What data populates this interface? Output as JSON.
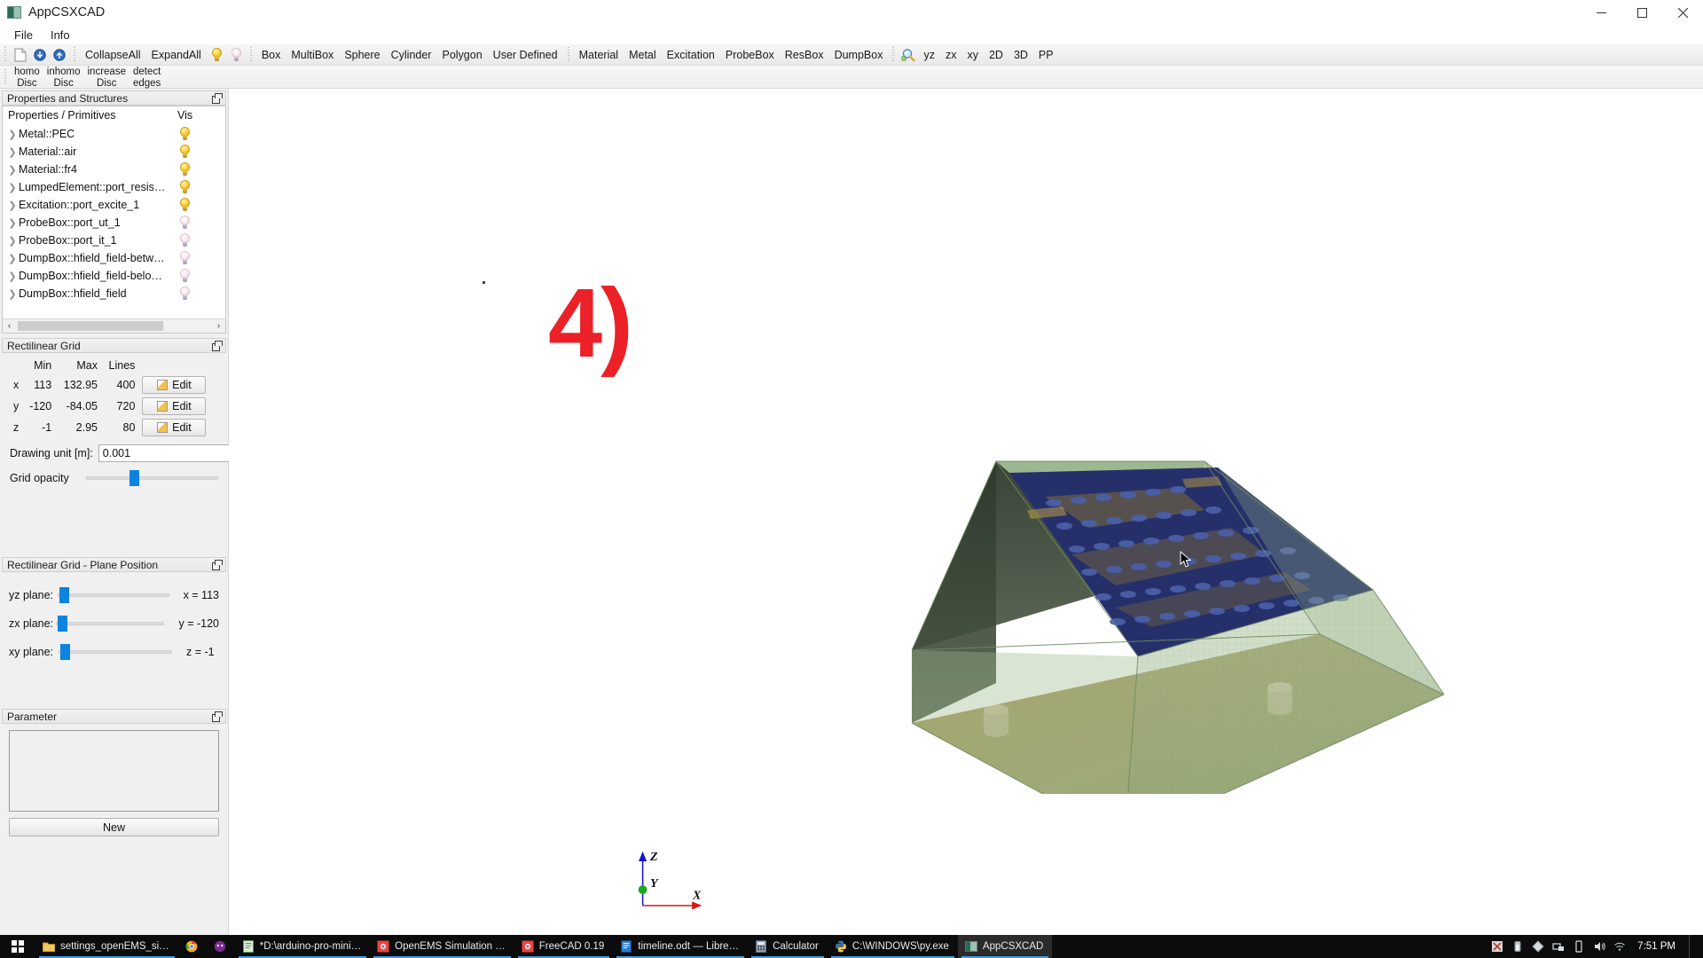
{
  "window": {
    "title": "AppCSXCAD",
    "app_icon": "app-window-icon",
    "minimize": "–",
    "maximize": "❐",
    "close": "✕"
  },
  "menubar": {
    "items": [
      {
        "label": "File"
      },
      {
        "label": "Info"
      }
    ]
  },
  "toolbar_main": {
    "icons": [
      {
        "name": "new-file-icon"
      },
      {
        "name": "open-down-icon"
      },
      {
        "name": "open-up-icon"
      }
    ],
    "group_tree": [
      {
        "label": "CollapseAll"
      },
      {
        "label": "ExpandAll"
      }
    ],
    "bulbs": [
      {
        "name": "bulb-on-icon",
        "state": "on"
      },
      {
        "name": "bulb-off-icon",
        "state": "off"
      }
    ],
    "group_primitives": [
      {
        "label": "Box"
      },
      {
        "label": "MultiBox"
      },
      {
        "label": "Sphere"
      },
      {
        "label": "Cylinder"
      },
      {
        "label": "Polygon"
      },
      {
        "label": "User Defined"
      }
    ],
    "group_properties": [
      {
        "label": "Material"
      },
      {
        "label": "Metal"
      },
      {
        "label": "Excitation"
      },
      {
        "label": "ProbeBox"
      },
      {
        "label": "ResBox"
      },
      {
        "label": "DumpBox"
      }
    ],
    "group_view_icon": {
      "name": "zoom-fit-icon"
    },
    "group_view": [
      {
        "label": "yz"
      },
      {
        "label": "zx"
      },
      {
        "label": "xy"
      },
      {
        "label": "2D"
      },
      {
        "label": "3D"
      },
      {
        "label": "PP"
      }
    ]
  },
  "toolbar_disc": {
    "items": [
      {
        "label": "homo\nDisc"
      },
      {
        "label": "inhomo\nDisc"
      },
      {
        "label": "increase\nDisc"
      },
      {
        "label": "detect\nedges"
      }
    ]
  },
  "properties_panel": {
    "title": "Properties and Structures",
    "columns": {
      "name": "Properties / Primitives",
      "vis": "Vis"
    },
    "rows": [
      {
        "label": "Metal::PEC",
        "vis": "on"
      },
      {
        "label": "Material::air",
        "vis": "on"
      },
      {
        "label": "Material::fr4",
        "vis": "on"
      },
      {
        "label": "LumpedElement::port_resis…",
        "vis": "on"
      },
      {
        "label": "Excitation::port_excite_1",
        "vis": "on"
      },
      {
        "label": "ProbeBox::port_ut_1",
        "vis": "off"
      },
      {
        "label": "ProbeBox::port_it_1",
        "vis": "off"
      },
      {
        "label": "DumpBox::hfield_field-betw…",
        "vis": "off"
      },
      {
        "label": "DumpBox::hfield_field-belo…",
        "vis": "off"
      },
      {
        "label": "DumpBox::hfield_field",
        "vis": "off"
      }
    ],
    "scroll_left": "‹",
    "scroll_right": "›"
  },
  "grid_panel": {
    "title": "Rectilinear Grid",
    "headers": {
      "min": "Min",
      "max": "Max",
      "lines": "Lines"
    },
    "rows": [
      {
        "axis": "x",
        "min": "113",
        "max": "132.95",
        "lines": "400",
        "edit": "Edit"
      },
      {
        "axis": "y",
        "min": "-120",
        "max": "-84.05",
        "lines": "720",
        "edit": "Edit"
      },
      {
        "axis": "z",
        "min": "-1",
        "max": "2.95",
        "lines": "80",
        "edit": "Edit"
      }
    ],
    "drawing_unit_label": "Drawing unit [m]:",
    "drawing_unit_value": "0.001",
    "grid_opacity_label": "Grid opacity",
    "grid_opacity_percent": 33
  },
  "plane_panel": {
    "title": "Rectilinear Grid - Plane Position",
    "rows": [
      {
        "label": "yz plane:",
        "value": "x = 113",
        "percent": 3
      },
      {
        "label": "zx plane:",
        "value": "y = -120",
        "percent": 3
      },
      {
        "label": "xy plane:",
        "value": "z = -1",
        "percent": 3
      }
    ]
  },
  "parameter_panel": {
    "title": "Parameter",
    "new_label": "New"
  },
  "viewport": {
    "annotation": "4)",
    "axes": {
      "x": "X",
      "y": "Y",
      "z": "Z"
    },
    "colors": {
      "annotation_red": "#ec2027",
      "pcb_blue": "#25306b",
      "pcb_copper": "#b08a2a",
      "box_green": "#8fae7e",
      "axis_x": "#d81717",
      "axis_y": "#1aa81a",
      "axis_z": "#1414c8"
    }
  },
  "taskbar": {
    "start": "start-button",
    "items": [
      {
        "label": "settings_openEMS_si…",
        "icon": "folder-icon",
        "state": "underline"
      },
      {
        "label": "",
        "icon": "chrome-icon",
        "state": "plain"
      },
      {
        "label": "",
        "icon": "purple-app-icon",
        "state": "plain"
      },
      {
        "label": "*D:\\arduino-pro-mini…",
        "icon": "notepad-icon",
        "state": "underline"
      },
      {
        "label": "OpenEMS Simulation …",
        "icon": "octave-icon",
        "state": "underline"
      },
      {
        "label": "FreeCAD 0.19",
        "icon": "freecad-icon",
        "state": "underline"
      },
      {
        "label": "timeline.odt — Libre…",
        "icon": "writer-icon",
        "state": "underline"
      },
      {
        "label": "Calculator",
        "icon": "calculator-icon",
        "state": "underline"
      },
      {
        "label": "C:\\WINDOWS\\py.exe",
        "icon": "python-icon",
        "state": "underline"
      },
      {
        "label": "AppCSXCAD",
        "icon": "appcsxcad-icon",
        "state": "active"
      }
    ],
    "tray": [
      {
        "name": "warning-tray-icon"
      },
      {
        "name": "battery-tray-icon"
      },
      {
        "name": "diamond-tray-icon"
      },
      {
        "name": "network-tray-icon"
      },
      {
        "name": "device-tray-icon"
      },
      {
        "name": "volume-tray-icon"
      },
      {
        "name": "wifi-tray-icon"
      }
    ],
    "clock": "7:51 PM"
  }
}
